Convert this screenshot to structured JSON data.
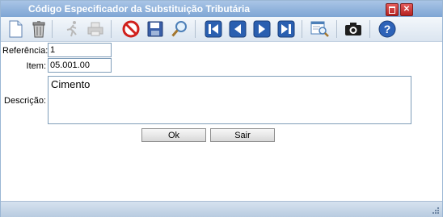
{
  "window": {
    "title": "Código Especificador da Substituição Tributária"
  },
  "toolbar": {
    "buttons": [
      {
        "name": "new",
        "icon": "new-document-icon",
        "enabled": true
      },
      {
        "name": "delete",
        "icon": "trash-icon",
        "enabled": true
      },
      {
        "name": "run",
        "icon": "running-man-icon",
        "enabled": false
      },
      {
        "name": "print",
        "icon": "printer-icon",
        "enabled": false
      },
      {
        "name": "cancel",
        "icon": "no-entry-icon",
        "enabled": true
      },
      {
        "name": "save",
        "icon": "floppy-disk-icon",
        "enabled": true
      },
      {
        "name": "search",
        "icon": "magnifier-icon",
        "enabled": true
      },
      {
        "name": "first",
        "icon": "first-record-icon",
        "enabled": true
      },
      {
        "name": "previous",
        "icon": "previous-record-icon",
        "enabled": true
      },
      {
        "name": "next",
        "icon": "next-record-icon",
        "enabled": true
      },
      {
        "name": "last",
        "icon": "last-record-icon",
        "enabled": true
      },
      {
        "name": "report",
        "icon": "report-search-icon",
        "enabled": true
      },
      {
        "name": "camera",
        "icon": "camera-icon",
        "enabled": true
      },
      {
        "name": "help",
        "icon": "help-icon",
        "enabled": true
      }
    ]
  },
  "form": {
    "referencia_label": "Referência:",
    "referencia_value": "1",
    "item_label": "Item:",
    "item_value": "05.001.00",
    "descricao_label": "Descrição:",
    "descricao_value": "Cimento"
  },
  "actions": {
    "ok_label": "Ok",
    "sair_label": "Sair"
  },
  "colors": {
    "titlebar": "#8fb2dc",
    "close_button": "#c93434",
    "nav_blue": "#2a5fb0"
  }
}
